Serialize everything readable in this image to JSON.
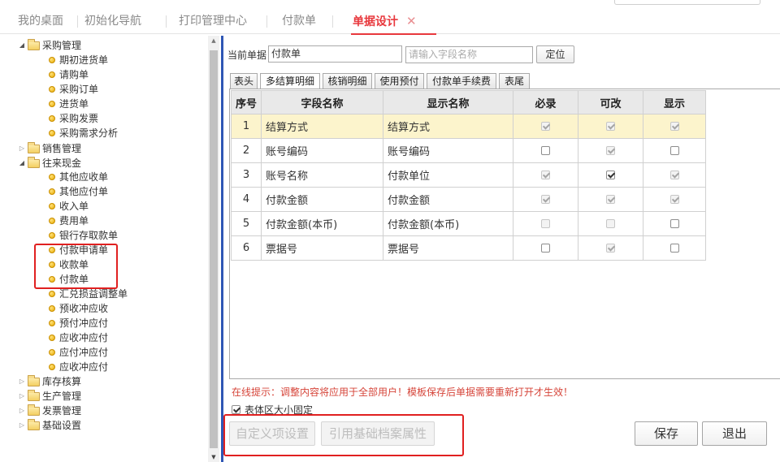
{
  "tabs": [
    {
      "label": "我的桌面"
    },
    {
      "label": "初始化导航"
    },
    {
      "label": "打印管理中心"
    },
    {
      "label": "付款单"
    },
    {
      "label": "单据设计",
      "close": "✕"
    }
  ],
  "tree": {
    "procurement": {
      "label": "采购管理",
      "children": [
        "期初进货单",
        "请购单",
        "采购订单",
        "进货单",
        "采购发票",
        "采购需求分析"
      ]
    },
    "sales": {
      "label": "销售管理"
    },
    "cash": {
      "label": "往来现金",
      "children": [
        "其他应收单",
        "其他应付单",
        "收入单",
        "费用单",
        "银行存取款单",
        "付款申请单",
        "收款单",
        "付款单",
        "汇兑损益调整单",
        "预收冲应收",
        "预付冲应付",
        "应收冲应付",
        "应付冲应付",
        "应收冲应付"
      ]
    },
    "inventory": {
      "label": "库存核算"
    },
    "production": {
      "label": "生产管理"
    },
    "invoice": {
      "label": "发票管理"
    },
    "basic": {
      "label": "基础设置"
    }
  },
  "panel": {
    "current_doc_label": "当前单据",
    "current_doc_value": "付款单",
    "field_search_placeholder": "请输入字段名称",
    "locate_button": "定位",
    "subtabs": [
      "表头",
      "多结算明细",
      "核销明细",
      "使用预付",
      "付款单手续费",
      "表尾"
    ],
    "active_subtab": "多结算明细",
    "columns": [
      "序号",
      "字段名称",
      "显示名称",
      "必录",
      "可改",
      "显示"
    ],
    "rows": [
      {
        "no": "1",
        "field": "结算方式",
        "display": "结算方式",
        "required": true,
        "editable": true,
        "visible": true,
        "req_dis": true,
        "edit_dis": true,
        "vis_dis": true
      },
      {
        "no": "2",
        "field": "账号编码",
        "display": "账号编码",
        "required": false,
        "editable": true,
        "visible": false,
        "req_dis": false,
        "edit_dis": true,
        "vis_dis": false
      },
      {
        "no": "3",
        "field": "账号名称",
        "display": "付款单位",
        "required": true,
        "editable": true,
        "visible": true,
        "req_dis": true,
        "edit_dis": false,
        "vis_dis": true
      },
      {
        "no": "4",
        "field": "付款金额",
        "display": "付款金额",
        "required": true,
        "editable": true,
        "visible": true,
        "req_dis": true,
        "edit_dis": true,
        "vis_dis": true
      },
      {
        "no": "5",
        "field": "付款金额(本币)",
        "display": "付款金额(本币)",
        "required": false,
        "editable": false,
        "visible": false,
        "req_dis": true,
        "edit_dis": true,
        "vis_dis": false
      },
      {
        "no": "6",
        "field": "票据号",
        "display": "票据号",
        "required": false,
        "editable": true,
        "visible": false,
        "req_dis": false,
        "edit_dis": true,
        "vis_dis": false
      }
    ],
    "hint": "在线提示：调整内容将应用于全部用户！模板保存后单据需要重新打开才生效！",
    "fixed_size_label": "表体区大小固定",
    "fixed_size_checked": true,
    "custom_button": "自定义项设置",
    "reference_button": "引用基础档案属性",
    "save_button": "保存",
    "exit_button": "退出"
  },
  "colors": {
    "accent": "#e8383d",
    "highlight_box": "#e02020",
    "selected_row": "#fcf4cc"
  }
}
